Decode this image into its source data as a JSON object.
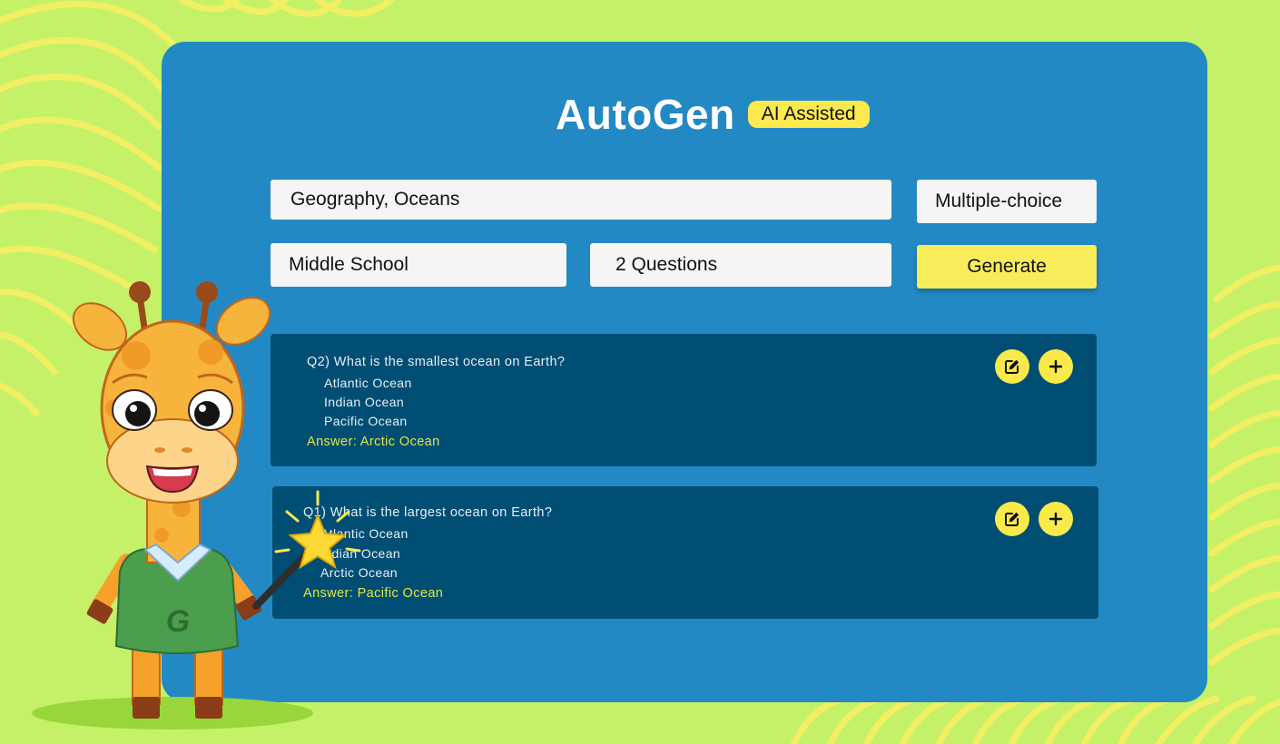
{
  "app": {
    "title": "AutoGen",
    "badge": "AI Assisted"
  },
  "form": {
    "topic": "Geography, Oceans",
    "question_type": "Multiple-choice",
    "level": "Middle School",
    "count": "2 Questions",
    "generate_label": "Generate"
  },
  "questions": [
    {
      "question": "Q2) What is the smallest ocean on Earth?",
      "options": [
        "Atlantic Ocean",
        "Indian Ocean",
        "Pacific Ocean"
      ],
      "answer": "Answer: Arctic Ocean"
    },
    {
      "question": "Q1) What is the largest ocean on Earth?",
      "options": [
        "Atlantic Ocean",
        "Indian Ocean",
        "Arctic Ocean"
      ],
      "answer": "Answer: Pacific Ocean"
    }
  ],
  "icons": {
    "edit": "edit-icon",
    "add": "plus-icon"
  },
  "mascot": {
    "shirt_letter": "G"
  },
  "colors": {
    "background": "#c5f169",
    "panel": "#2389c5",
    "card": "#014e74",
    "accent_yellow": "#f8ec5b",
    "answer_text": "#e3e641"
  }
}
